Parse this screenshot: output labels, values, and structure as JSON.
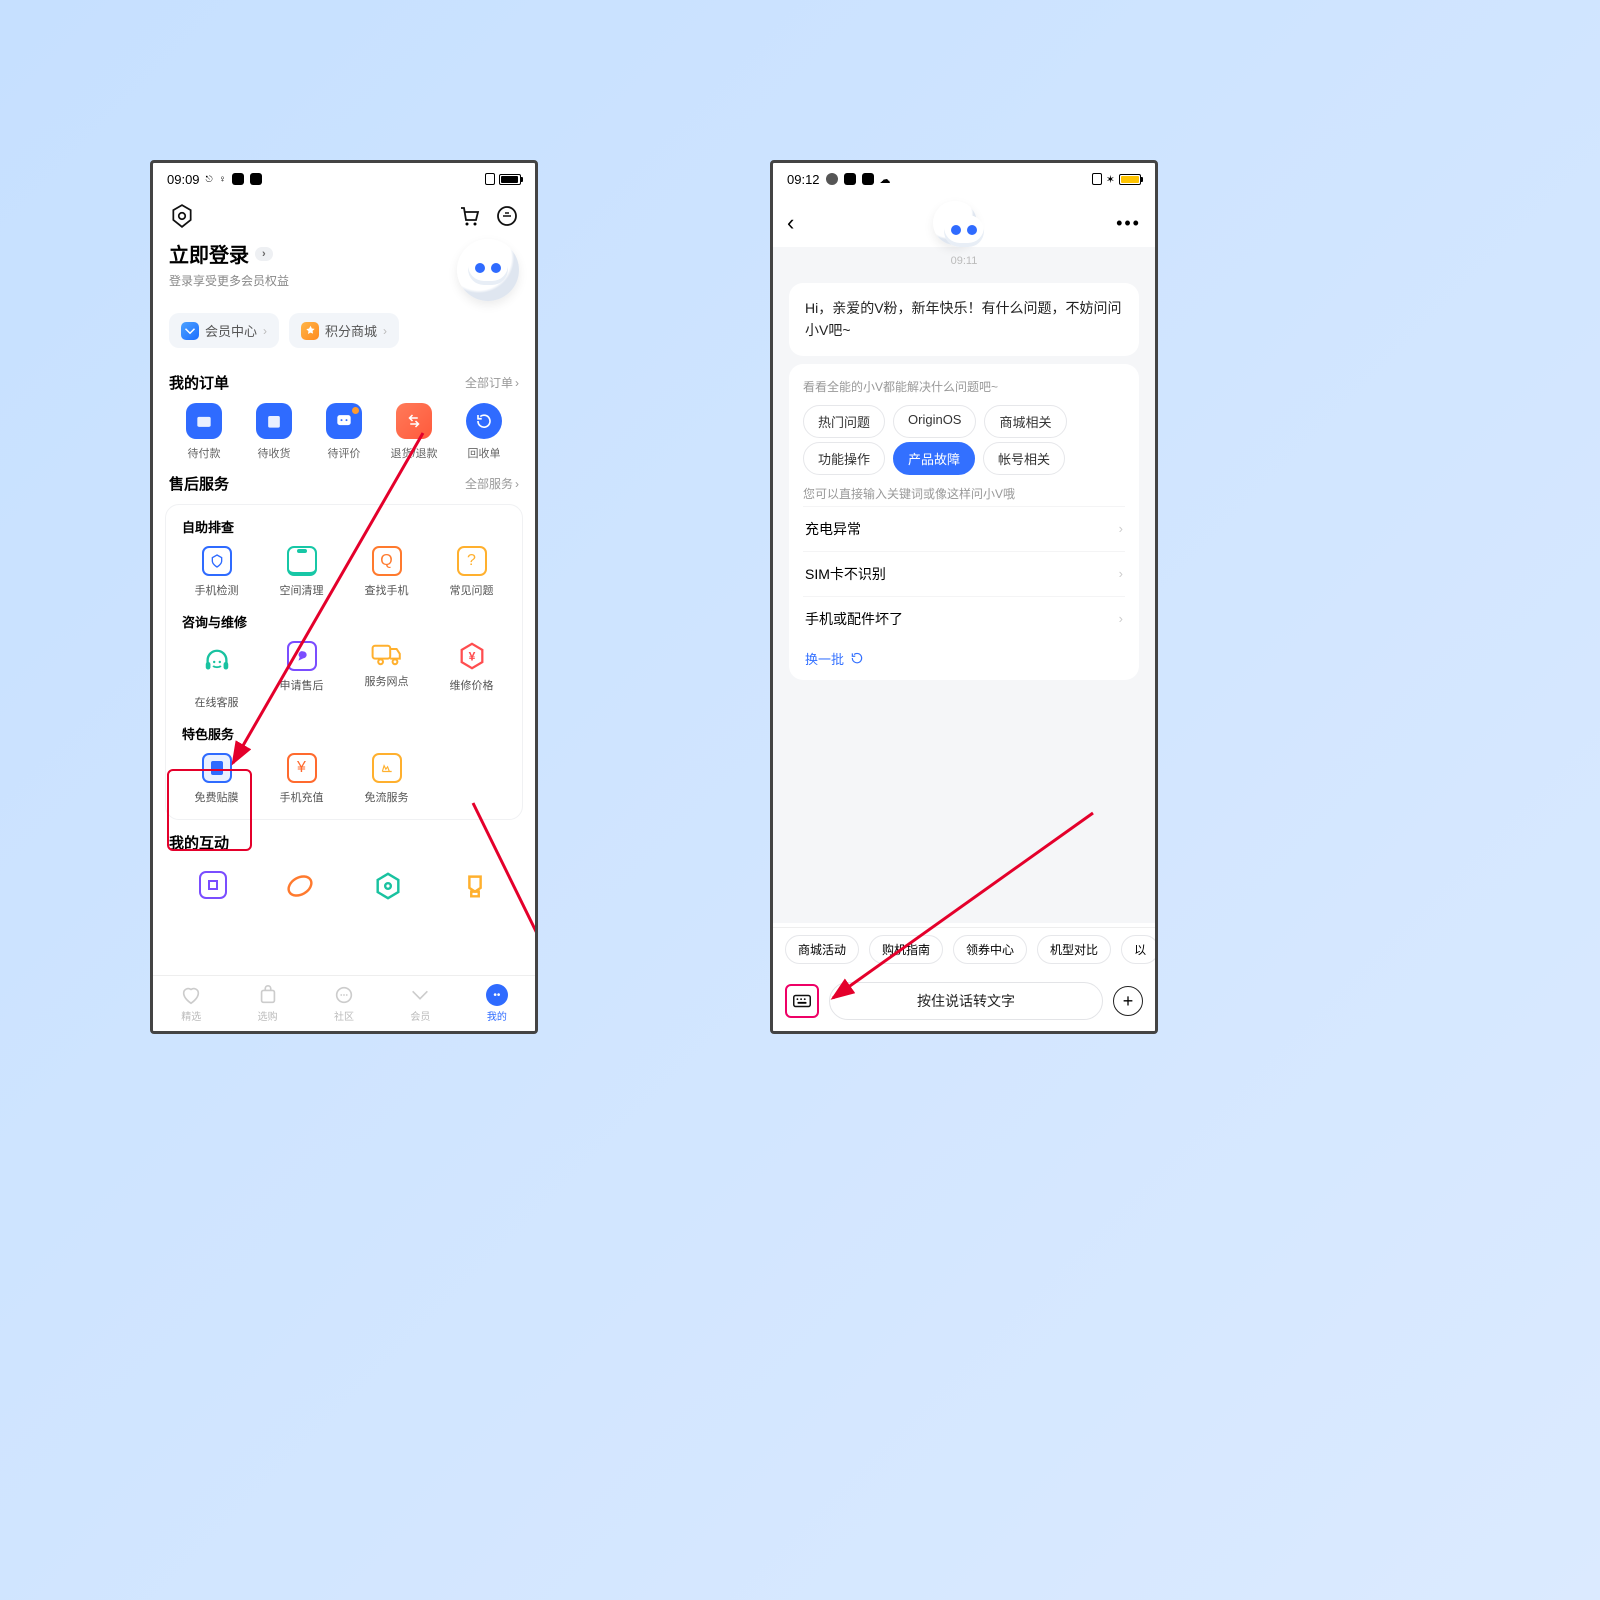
{
  "left": {
    "status": {
      "time": "09:09"
    },
    "header": {},
    "login": {
      "title": "立即登录",
      "sub": "登录享受更多会员权益"
    },
    "chips": {
      "vip": "会员中心",
      "points": "积分商城"
    },
    "orders": {
      "title": "我的订单",
      "more": "全部订单",
      "items": [
        "待付款",
        "待收货",
        "待评价",
        "退货/退款",
        "回收单"
      ]
    },
    "aftersale": {
      "title": "售后服务",
      "more": "全部服务"
    },
    "groups": {
      "diag": {
        "title": "自助排查",
        "items": [
          "手机检测",
          "空间清理",
          "查找手机",
          "常见问题"
        ]
      },
      "repair": {
        "title": "咨询与维修",
        "items": [
          "在线客服",
          "申请售后",
          "服务网点",
          "维修价格"
        ]
      },
      "special": {
        "title": "特色服务",
        "items": [
          "免费贴膜",
          "手机充值",
          "免流服务"
        ]
      }
    },
    "interact": {
      "title": "我的互动"
    },
    "tabs": [
      "精选",
      "选购",
      "社区",
      "会员",
      "我的"
    ]
  },
  "right": {
    "status": {
      "time": "09:12"
    },
    "chat_time": "09:11",
    "greet": "Hi，亲爱的V粉，新年快乐！有什么问题，不妨问问小V吧~",
    "card": {
      "hint": "看看全能的小V都能解决什么问题吧~",
      "pills": [
        "热门问题",
        "OriginOS",
        "商城相关",
        "功能操作",
        "产品故障",
        "帐号相关"
      ],
      "hint2": "您可以直接输入关键词或像这样问小V哦",
      "questions": [
        "充电异常",
        "SIM卡不识别",
        "手机或配件坏了"
      ],
      "refresh": "换一批"
    },
    "chipbar": [
      "商城活动",
      "购机指南",
      "领券中心",
      "机型对比",
      "以"
    ],
    "talk": "按住说话转文字"
  }
}
